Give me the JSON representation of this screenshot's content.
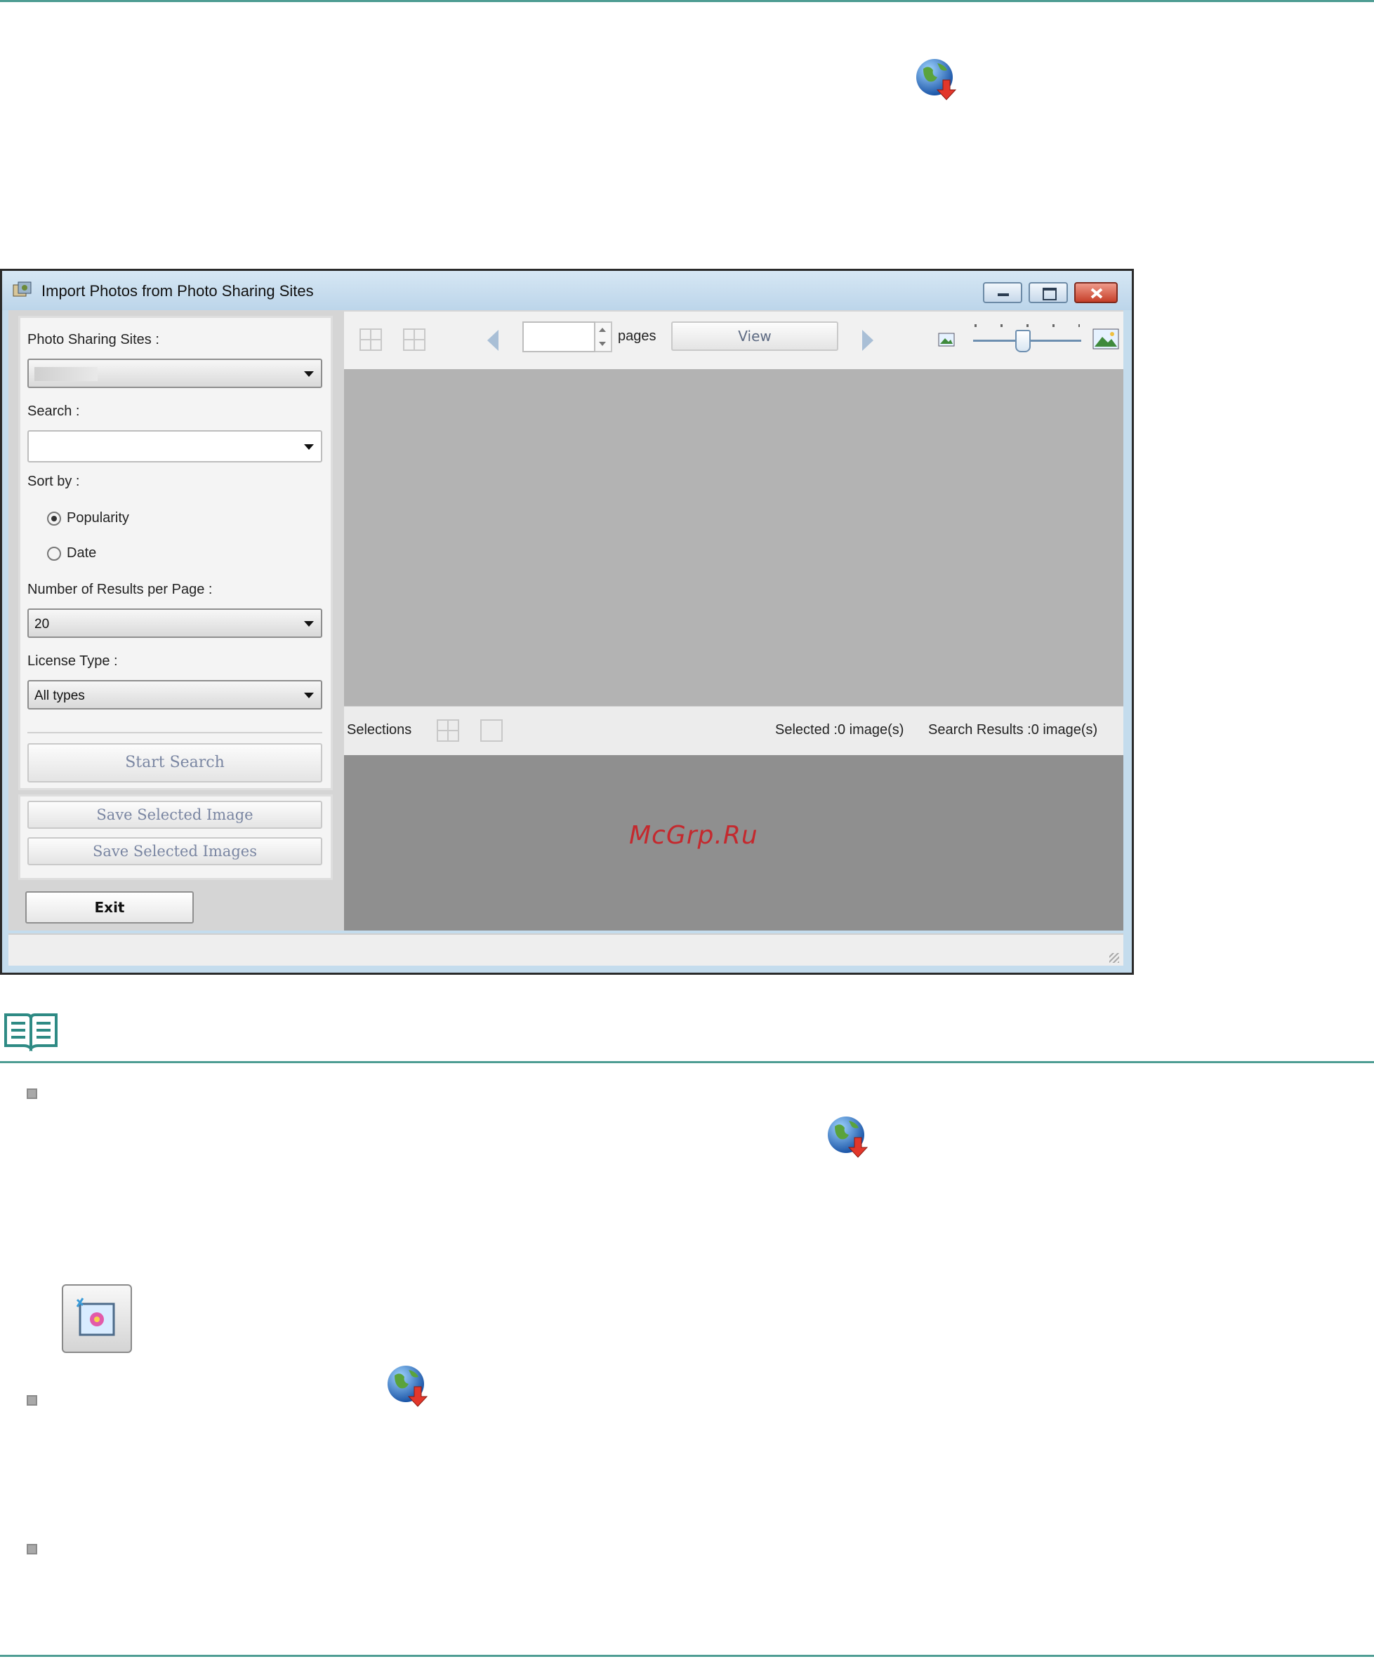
{
  "window": {
    "title": "Import Photos from Photo Sharing Sites",
    "left_panel": {
      "photo_sharing_sites_label": "Photo Sharing Sites :",
      "photo_sharing_sites_value": "",
      "search_label": "Search :",
      "search_value": "",
      "sort_by_label": "Sort by :",
      "sort_options": [
        "Popularity",
        "Date"
      ],
      "sort_selected": "Popularity",
      "results_per_page_label": "Number of Results per Page :",
      "results_per_page_value": "20",
      "license_type_label": "License Type :",
      "license_type_value": "All types",
      "start_search_button": "Start Search",
      "save_selected_image_button": "Save Selected Image",
      "save_selected_images_button": "Save Selected Images",
      "exit_button": "Exit"
    },
    "toolbar": {
      "page_input_value": "",
      "pages_label": "pages",
      "view_button": "View"
    },
    "selections_bar": {
      "selections_label": "Selections",
      "selected_count": "Selected :0 image(s)",
      "search_results_count": "Search Results :0 image(s)"
    },
    "watermark": "McGrp.Ru"
  },
  "icons": {
    "globe": "globe-download-icon",
    "note": "open-book-note-icon",
    "photo_button": "photo-edit-button-icon",
    "app": "app-photos-icon"
  },
  "colors": {
    "rule": "#4e9d93",
    "watermark": "#c4292e",
    "close_button": "#c6402a"
  }
}
